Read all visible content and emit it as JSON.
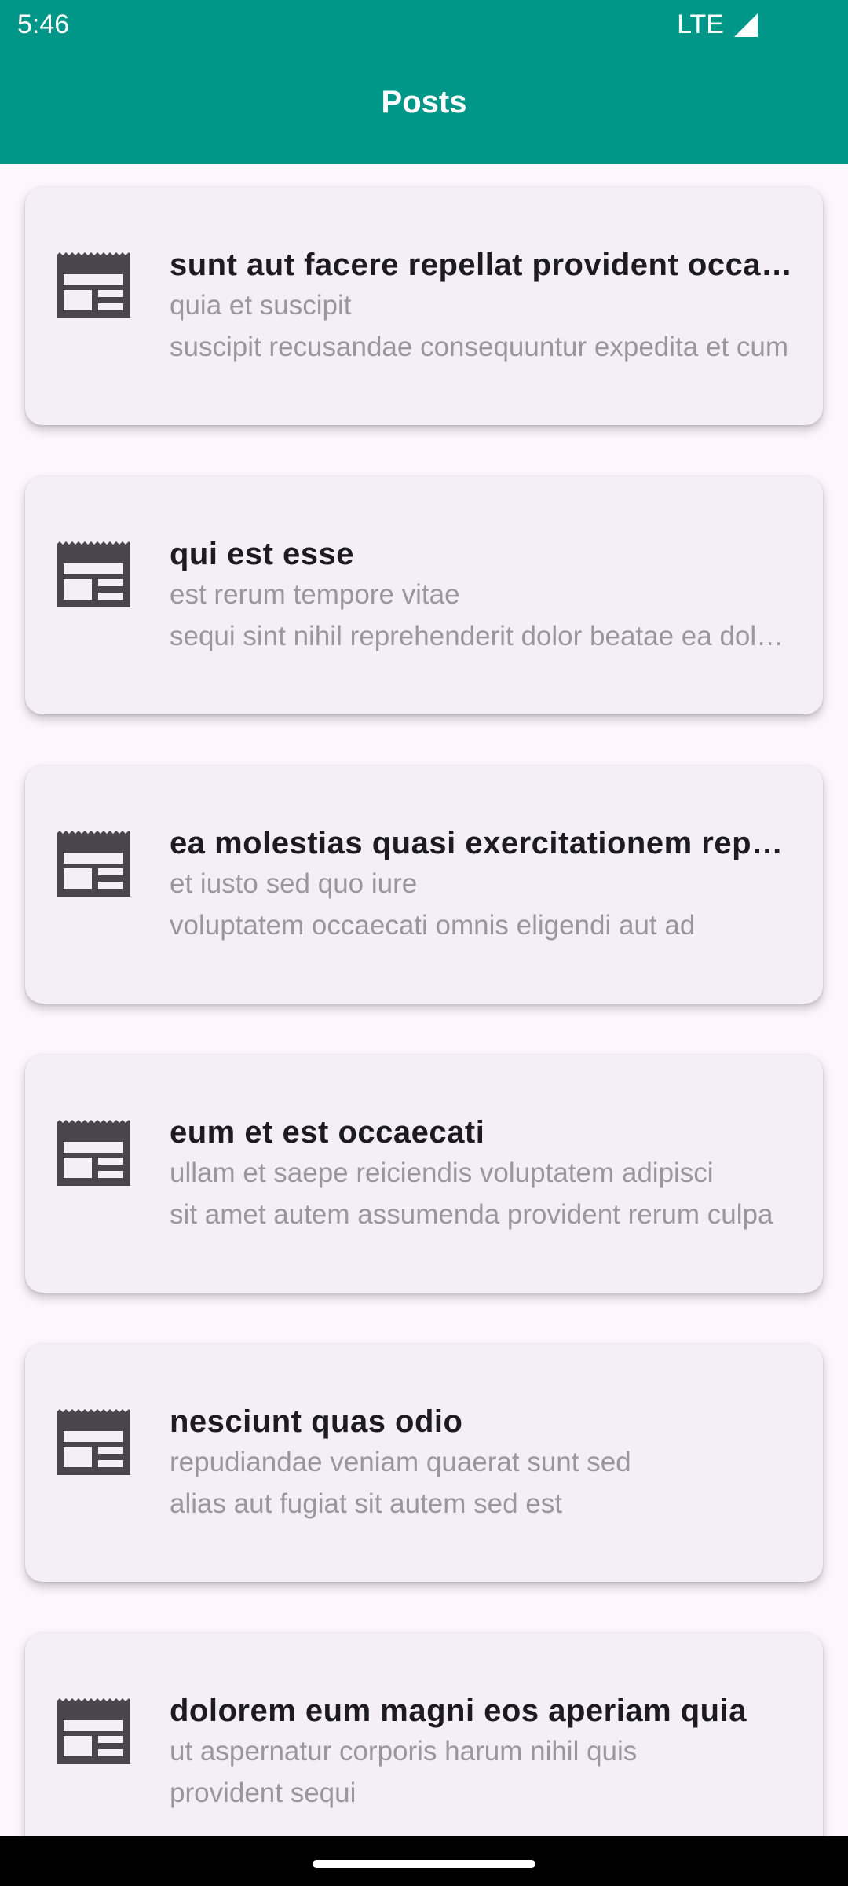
{
  "status_bar": {
    "time": "5:46",
    "network": "LTE"
  },
  "app_bar": {
    "title": "Posts"
  },
  "posts": [
    {
      "title": "sunt aut facere repellat provident occaecati excepturi optio reprehenderit",
      "line1": "quia et suscipit",
      "line2": "suscipit recusandae consequuntur expedita et cum"
    },
    {
      "title": "qui est esse",
      "line1": "est rerum tempore vitae",
      "line2": "sequi sint nihil reprehenderit dolor beatae ea dolores neque"
    },
    {
      "title": "ea molestias quasi exercitationem repellat qui ipsa sit aut",
      "line1": "et iusto sed quo iure",
      "line2": "voluptatem occaecati omnis eligendi aut ad"
    },
    {
      "title": "eum et est occaecati",
      "line1": "ullam et saepe reiciendis voluptatem adipisci",
      "line2": "sit amet autem assumenda provident rerum culpa"
    },
    {
      "title": "nesciunt quas odio",
      "line1": "repudiandae veniam quaerat sunt sed",
      "line2": "alias aut fugiat sit autem sed est"
    },
    {
      "title": "dolorem eum magni eos aperiam quia",
      "line1": "ut aspernatur corporis harum nihil quis",
      "line2": "provident sequi"
    }
  ],
  "icons": {
    "post": "article-icon",
    "signal": "signal-icon"
  },
  "colors": {
    "app_bar": "#009688",
    "background": "#fdf7fd",
    "card": "#f4eff6",
    "icon": "#49454f"
  }
}
